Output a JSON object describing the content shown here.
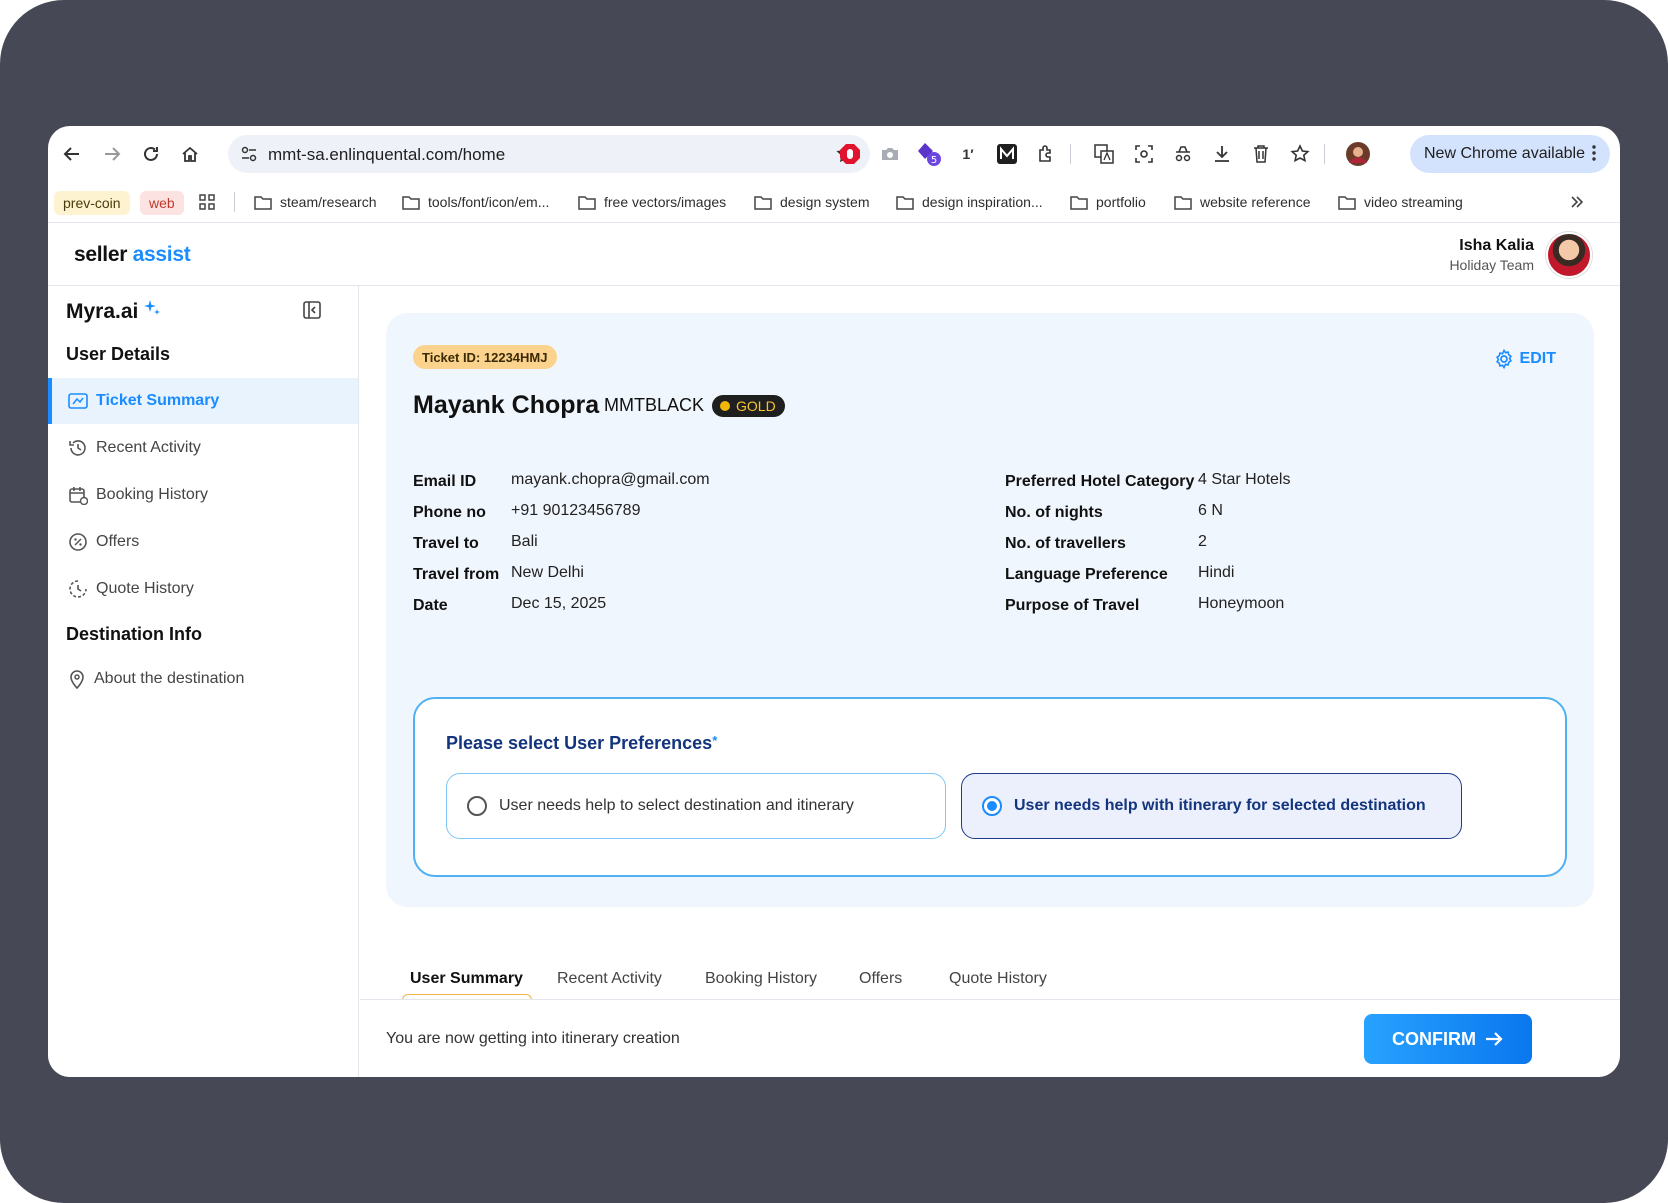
{
  "browser": {
    "url": "mmt-sa.enlinquental.com/home",
    "update_label": "New Chrome available",
    "extension_badge": "5",
    "ext_text": "1′",
    "bookmarks": {
      "chip1": "prev-coin",
      "chip2": "web",
      "items": [
        "steam/research",
        "tools/font/icon/em...",
        "free vectors/images",
        "design system",
        "design inspiration...",
        "portfolio",
        "website reference",
        "video streaming"
      ]
    }
  },
  "header": {
    "brand_main": "seller",
    "brand_accent": "assist",
    "user_name": "Isha Kalia",
    "user_team": "Holiday Team"
  },
  "sidebar": {
    "title": "Myra.ai",
    "section1": "User Details",
    "items": [
      "Ticket Summary",
      "Recent Activity",
      "Booking History",
      "Offers",
      "Quote History"
    ],
    "section2": "Destination Info",
    "dest_item": "About the destination"
  },
  "ticket": {
    "id_label": "Ticket ID: 12234HMJ",
    "edit_label": "EDIT",
    "customer_name": "Mayank Chopra",
    "customer_code": "MMTBLACK",
    "tier": "GOLD",
    "left_fields": [
      {
        "label": "Email ID",
        "value": "mayank.chopra@gmail.com"
      },
      {
        "label": "Phone no",
        "value": "+91 90123456789"
      },
      {
        "label": "Travel to",
        "value": "Bali"
      },
      {
        "label": "Travel from",
        "value": "New Delhi"
      },
      {
        "label": "Date",
        "value": "Dec 15, 2025"
      }
    ],
    "right_fields": [
      {
        "label": "Preferred Hotel Category",
        "value": "4 Star Hotels"
      },
      {
        "label": "No. of nights",
        "value": "6 N"
      },
      {
        "label": "No. of travellers",
        "value": "2"
      },
      {
        "label": "Language Preference",
        "value": "Hindi"
      },
      {
        "label": "Purpose of Travel",
        "value": "Honeymoon"
      }
    ]
  },
  "preferences": {
    "title": "Please select User Preferences",
    "required_mark": "*",
    "options": [
      {
        "label": "User needs help to select destination and itinerary",
        "selected": false
      },
      {
        "label": "User needs help with itinerary for selected destination",
        "selected": true
      }
    ]
  },
  "tabs": [
    "User Summary",
    "Recent Activity",
    "Booking History",
    "Offers",
    "Quote History"
  ],
  "footer": {
    "message": "You are now getting into itinerary creation",
    "confirm_label": "CONFIRM"
  },
  "colors": {
    "accent": "#1a8cff",
    "frame": "#464856",
    "card_bg": "#f0f6fd",
    "ticket_badge": "#fbd38d",
    "gold": "#f7c331",
    "pref_title": "#13357d"
  }
}
